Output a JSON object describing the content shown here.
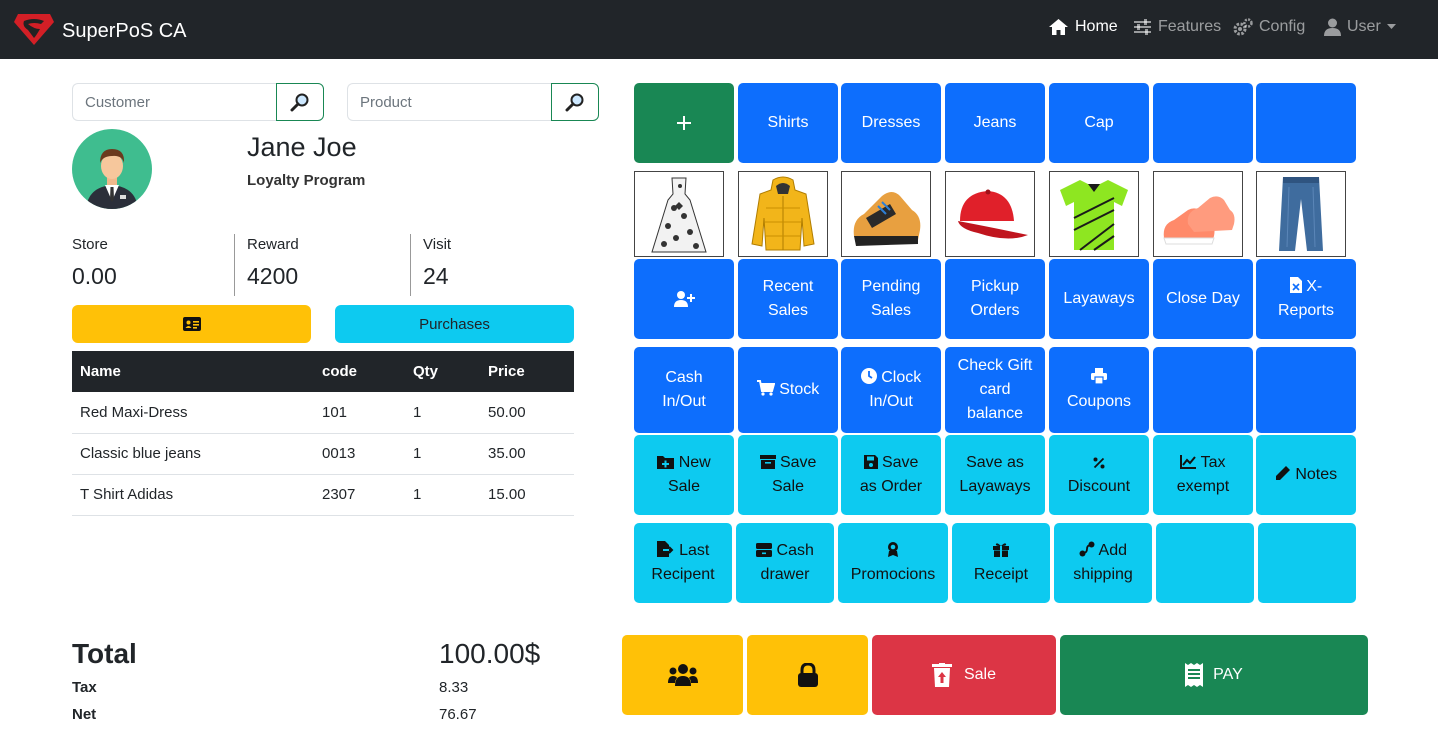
{
  "app": {
    "title": "SuperPoS CA"
  },
  "nav": {
    "home": "Home",
    "features": "Features",
    "config": "Config",
    "user": "User"
  },
  "search": {
    "customer_placeholder": "Customer",
    "product_placeholder": "Product"
  },
  "customer": {
    "name": "Jane Joe",
    "program": "Loyalty Program",
    "stats": [
      {
        "label": "Store",
        "value": "0.00"
      },
      {
        "label": "Reward",
        "value": "4200"
      },
      {
        "label": "Visit",
        "value": "24"
      }
    ],
    "purchases_label": "Purchases"
  },
  "cart": {
    "headers": [
      "Name",
      "code",
      "Qty",
      "Price"
    ],
    "rows": [
      {
        "name": "Red Maxi-Dress",
        "code": "101",
        "qty": "1",
        "price": "50.00"
      },
      {
        "name": "Classic blue jeans",
        "code": "0013",
        "qty": "1",
        "price": "35.00"
      },
      {
        "name": "T Shirt Adidas",
        "code": "2307",
        "qty": "1",
        "price": "15.00"
      }
    ]
  },
  "totals": {
    "total_label": "Total",
    "total_value": "100.00$",
    "tax_label": "Tax",
    "tax_value": "8.33",
    "net_label": "Net",
    "net_value": "76.67"
  },
  "categories": [
    "Shirts",
    "Dresses",
    "Jeans",
    "Cap"
  ],
  "products": [
    "dress",
    "jacket",
    "sneaker",
    "cap",
    "shirt",
    "kids-shoes",
    "jeans"
  ],
  "actions_row1": {
    "recent_sales": [
      "Recent",
      "Sales"
    ],
    "pending_sales": [
      "Pending",
      "Sales"
    ],
    "pickup_orders": [
      "Pickup",
      "Orders"
    ],
    "layaways": "Layaways",
    "close_day": "Close Day",
    "x_reports": [
      "X-",
      "Reports"
    ]
  },
  "actions_row2": {
    "cash_inout": [
      "Cash",
      "In/Out"
    ],
    "stock": "Stock",
    "clock_inout": [
      "Clock",
      "In/Out"
    ],
    "gift_card": [
      "Check Gift",
      "card",
      "balance"
    ],
    "coupons": "Coupons"
  },
  "actions_row3": {
    "new_sale": [
      "New",
      "Sale"
    ],
    "save_sale": [
      "Save",
      "Sale"
    ],
    "save_order": [
      "Save",
      "as Order"
    ],
    "save_layaways": [
      "Save as",
      "Layaways"
    ],
    "discount": "Discount",
    "tax_exempt": [
      "Tax",
      "exempt"
    ],
    "notes": "Notes"
  },
  "actions_row4": {
    "last_recipient": [
      "Last",
      "Recipent"
    ],
    "cash_drawer": [
      "Cash",
      "drawer"
    ],
    "promotions": "Promocions",
    "receipt": "Receipt",
    "add_shipping": [
      "Add",
      "shipping"
    ]
  },
  "bottom": {
    "sale": "Sale",
    "pay": "PAY"
  },
  "colors": {
    "blue": "#0d6efd",
    "cyan": "#0dcaf0",
    "green": "#198754",
    "yellow": "#ffc107",
    "red": "#dc3545",
    "dark": "#212529"
  }
}
